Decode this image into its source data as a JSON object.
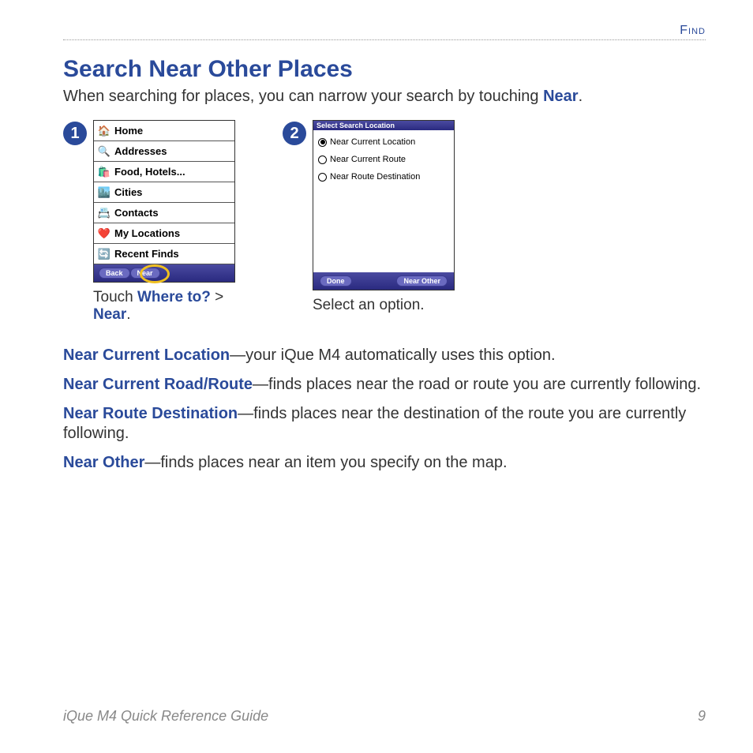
{
  "header": {
    "section": "Find"
  },
  "title": "Search Near Other Places",
  "intro": {
    "pre": "When searching for places, you can narrow your search by touching ",
    "link": "Near",
    "post": "."
  },
  "step1": {
    "badge": "1",
    "menu": [
      {
        "icon": "home-icon",
        "glyph": "🏠",
        "label": "Home"
      },
      {
        "icon": "search-icon",
        "glyph": "🔍",
        "label": "Addresses"
      },
      {
        "icon": "food-icon",
        "glyph": "🛍️",
        "label": "Food, Hotels..."
      },
      {
        "icon": "cities-icon",
        "glyph": "🏙️",
        "label": "Cities"
      },
      {
        "icon": "contacts-icon",
        "glyph": "📇",
        "label": "Contacts"
      },
      {
        "icon": "heart-icon",
        "glyph": "❤️",
        "label": "My Locations"
      },
      {
        "icon": "recent-icon",
        "glyph": "🔄",
        "label": "Recent Finds"
      }
    ],
    "back": "Back",
    "near": "Near",
    "caption_pre": "Touch ",
    "caption_link1": "Where to?",
    "caption_mid": " > ",
    "caption_link2": "Near",
    "caption_post": "."
  },
  "step2": {
    "badge": "2",
    "titlebar": "Select Search Location",
    "options": [
      {
        "label": "Near Current Location",
        "selected": true
      },
      {
        "label": "Near Current Route",
        "selected": false
      },
      {
        "label": "Near Route Destination",
        "selected": false
      }
    ],
    "done": "Done",
    "near_other": "Near Other",
    "caption": "Select an option."
  },
  "defs": [
    {
      "term": "Near Current Location",
      "desc": "—your iQue M4 automatically uses this option."
    },
    {
      "term": "Near Current Road/Route",
      "desc": "—finds places near the road or route you are currently following."
    },
    {
      "term": "Near Route Destination",
      "desc": "—finds places near the destination of the route you are currently following."
    },
    {
      "term": "Near Other",
      "desc": "—finds places near an item you specify on the map."
    }
  ],
  "footer": {
    "title": "iQue M4 Quick Reference Guide",
    "page": "9"
  }
}
